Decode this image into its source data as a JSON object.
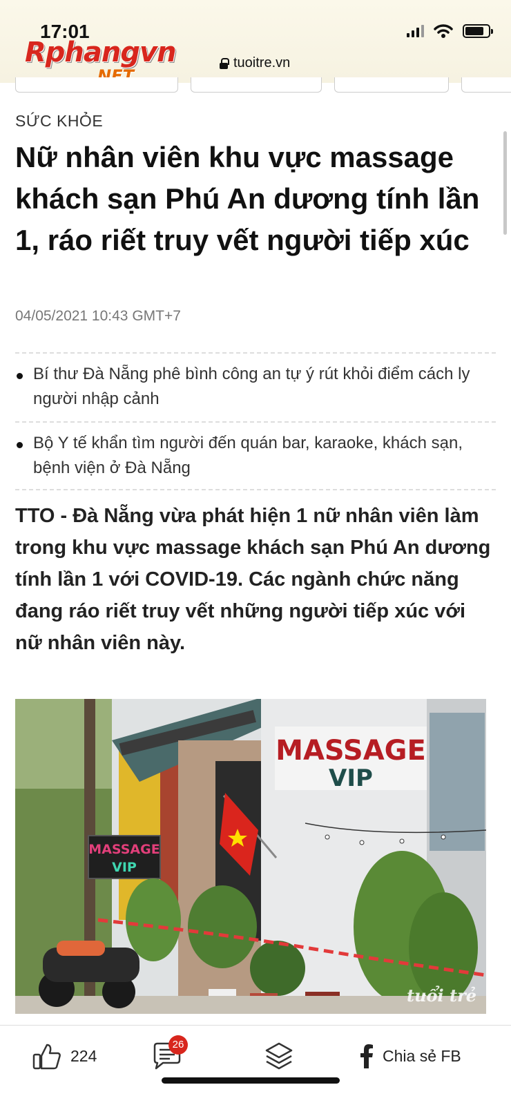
{
  "status_bar": {
    "time": "17:01"
  },
  "browser": {
    "logo_main": "Rphangvn",
    "logo_sub": ".NET",
    "url": "tuoitre.vn"
  },
  "article": {
    "category": "SỨC KHỎE",
    "title": "Nữ nhân viên khu vực massage khách sạn Phú An dương tính lần 1, ráo riết truy vết người tiếp xúc",
    "date": "04/05/2021 10:43 GMT+7",
    "related": [
      {
        "label": "Bí thư Đà Nẵng phê bình công an tự ý rút khỏi điểm cách ly người nhập cảnh"
      },
      {
        "label": "Bộ Y tế khẩn tìm người đến quán bar, karaoke, khách sạn, bệnh viện ở Đà Nẵng"
      }
    ],
    "lede": "TTO - Đà Nẵng vừa phát hiện 1 nữ nhân viên làm trong khu vực massage khách sạn Phú An dương tính lần 1 với COVID-19. Các ngành chức năng đang ráo riết truy vết những người tiếp xúc với nữ nhân viên này.",
    "photo": {
      "sign_main_line1": "MASSAGE",
      "sign_main_line2": "VIP",
      "sign_small_line1": "MASSAGE",
      "sign_small_line2": "VIP",
      "watermark": "tuổi trẻ"
    }
  },
  "bottom_bar": {
    "like_count": "224",
    "comment_badge": "26",
    "share_label": "Chia sẻ FB"
  },
  "colors": {
    "brand_red": "#d8261d",
    "flag_red": "#da251d",
    "flag_star": "#ffde00"
  }
}
